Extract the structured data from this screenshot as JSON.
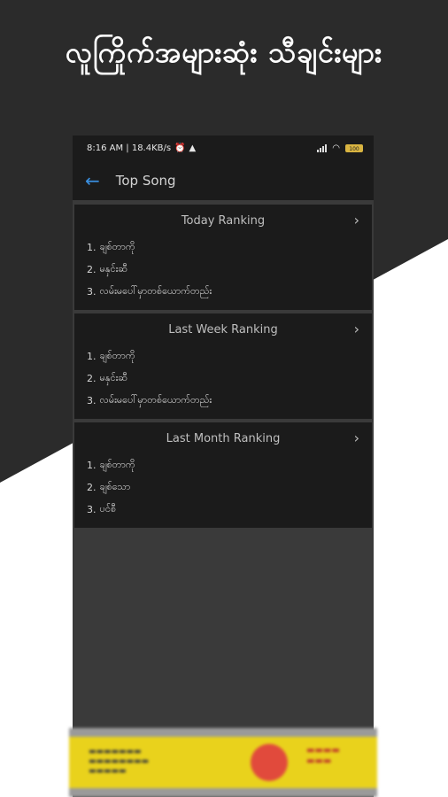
{
  "banner": {
    "title": "လူကြိုက်အများဆုံး သီချင်းများ"
  },
  "status_bar": {
    "time_speed": "8:16 AM | 18.4KB/s",
    "alarm_icon": "alarm-icon",
    "warning_icon": "warning-icon",
    "battery_text": "100"
  },
  "toolbar": {
    "title": "Top Song",
    "back_icon": "arrow-left-icon"
  },
  "rankings": [
    {
      "title": "Today Ranking",
      "items": [
        {
          "num": "1.",
          "name": "ချစ်တာကို"
        },
        {
          "num": "2.",
          "name": "မနှင်းဆီ"
        },
        {
          "num": "3.",
          "name": "လမ်းမပေါ်မှာတစ်ယောက်တည်း"
        }
      ]
    },
    {
      "title": "Last Week Ranking",
      "items": [
        {
          "num": "1.",
          "name": "ချစ်တာကို"
        },
        {
          "num": "2.",
          "name": "မနှင်းဆီ"
        },
        {
          "num": "3.",
          "name": "လမ်းမပေါ်မှာတစ်ယောက်တည်း"
        }
      ]
    },
    {
      "title": "Last Month Ranking",
      "items": [
        {
          "num": "1.",
          "name": "ချစ်တာကို"
        },
        {
          "num": "2.",
          "name": "ချစ်သော"
        },
        {
          "num": "3.",
          "name": "ပင်စီ"
        }
      ]
    }
  ],
  "colors": {
    "background_dark": "#2b2b2b",
    "surface": "#1b1b1b",
    "accent": "#3a8fe0",
    "ad_yellow": "#e9d21c"
  }
}
